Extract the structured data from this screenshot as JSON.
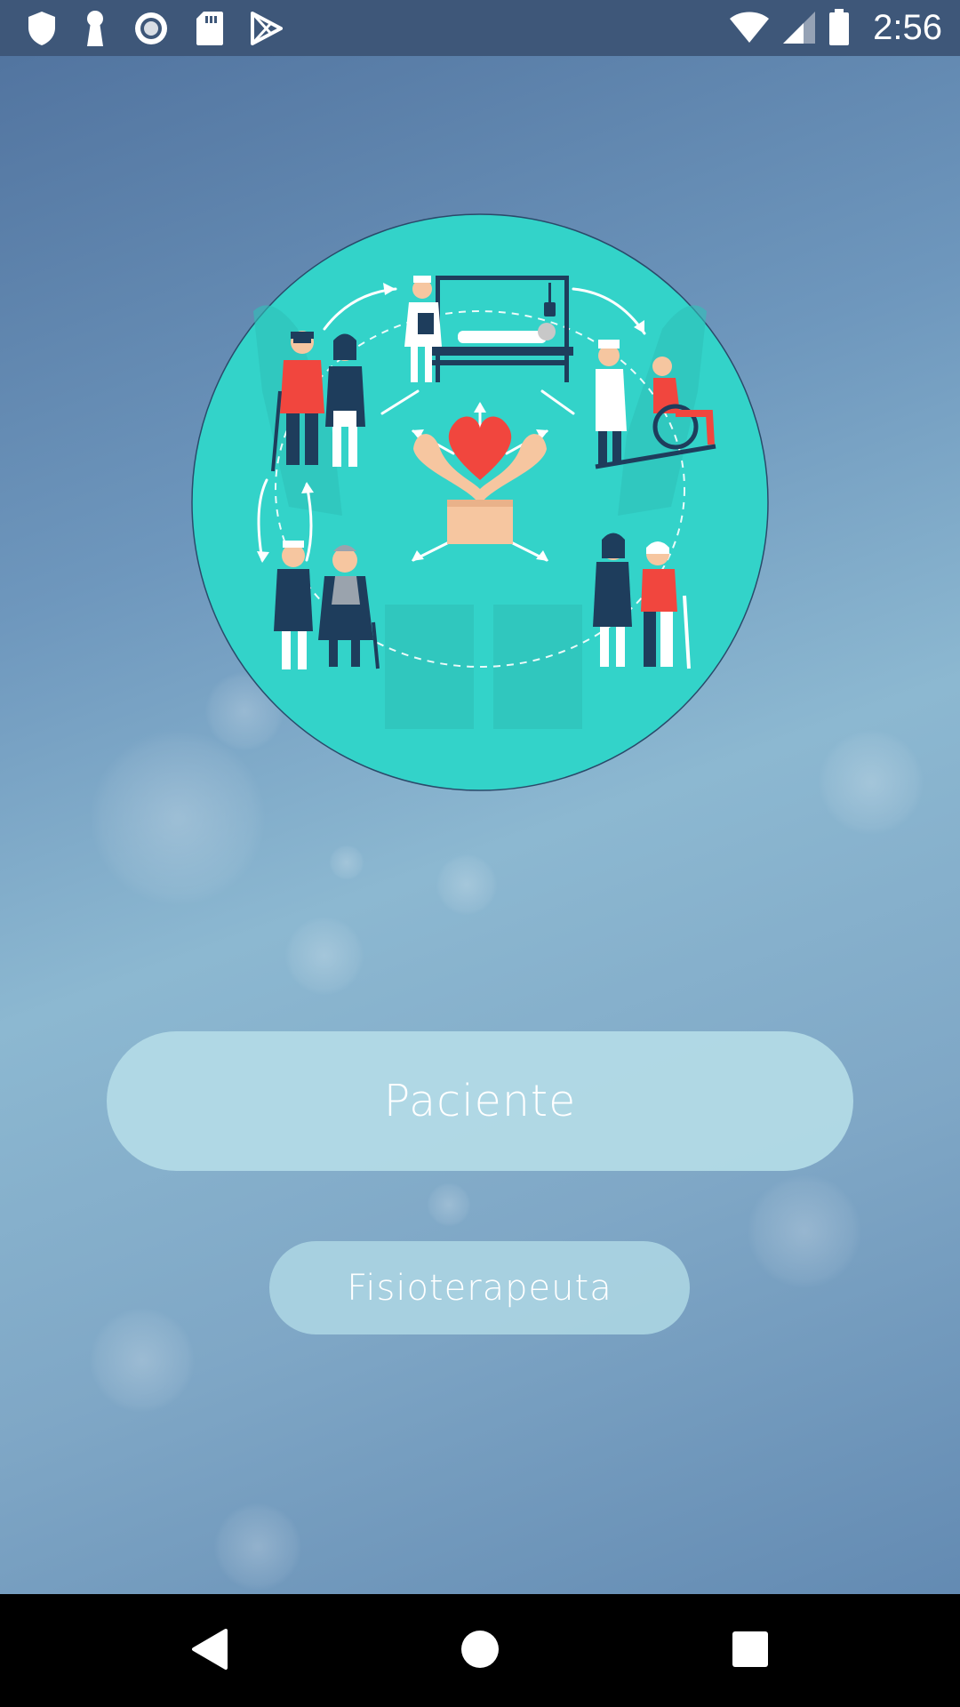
{
  "status_bar": {
    "time": "2:56",
    "left_icons": [
      "shield-icon",
      "keyhole-icon",
      "record-icon",
      "sd-card-icon",
      "play-store-icon"
    ],
    "right_icons": [
      "wifi-icon",
      "signal-icon",
      "battery-icon"
    ]
  },
  "main": {
    "illustration": "healthcare-circle-illustration",
    "buttons": {
      "paciente_label": "Paciente",
      "fisioterapeuta_label": "Fisioterapeuta"
    }
  },
  "nav_bar": {
    "items": [
      "back-icon",
      "home-icon",
      "recents-icon"
    ]
  },
  "colors": {
    "status_bar": "#3e5779",
    "illustration_teal": "#33d3c9",
    "button_bg": "#b2dae6",
    "button_text": "#ffffff",
    "heart": "#f1463e"
  }
}
